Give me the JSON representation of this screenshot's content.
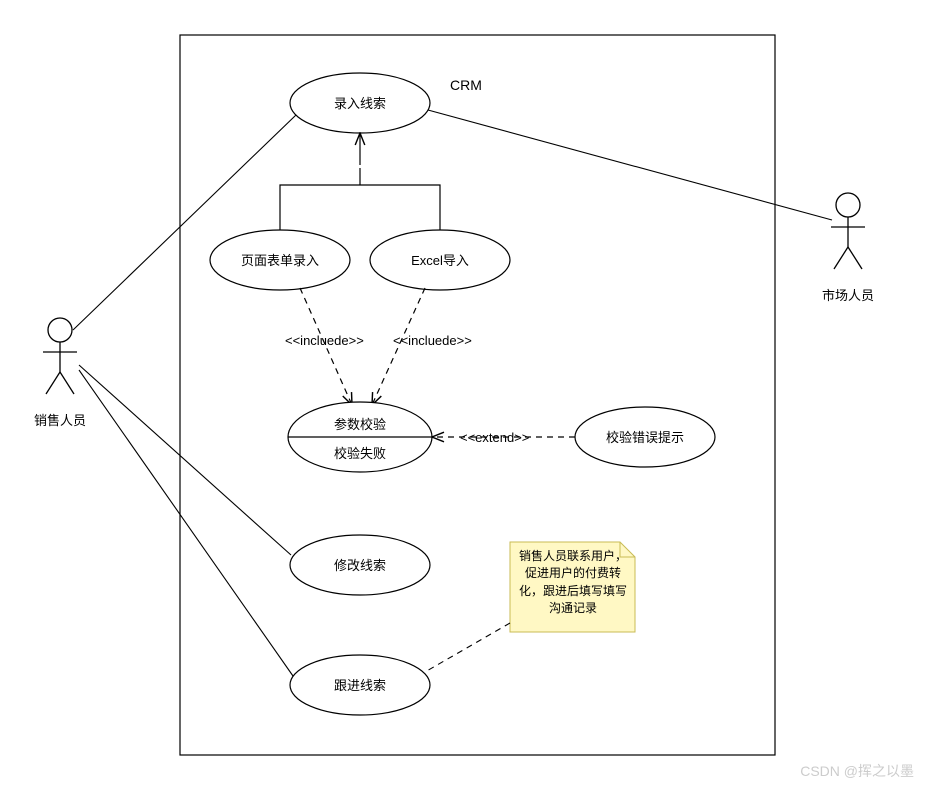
{
  "system": {
    "name": "CRM"
  },
  "actors": {
    "left": "销售人员",
    "right": "市场人员"
  },
  "usecases": {
    "enter": "录入线索",
    "form": "页面表单录入",
    "excel": "Excel导入",
    "param_top": "参数校验",
    "param_bottom": "校验失败",
    "errtip": "校验错误提示",
    "modify": "修改线索",
    "follow": "跟进线索"
  },
  "relations": {
    "include": "<<incluede>>",
    "extend": "<<extend>>"
  },
  "note": "销售人员联系用户，促进用户的付费转化，跟进后填写填写沟通记录",
  "watermark": "CSDN @挥之以墨"
}
